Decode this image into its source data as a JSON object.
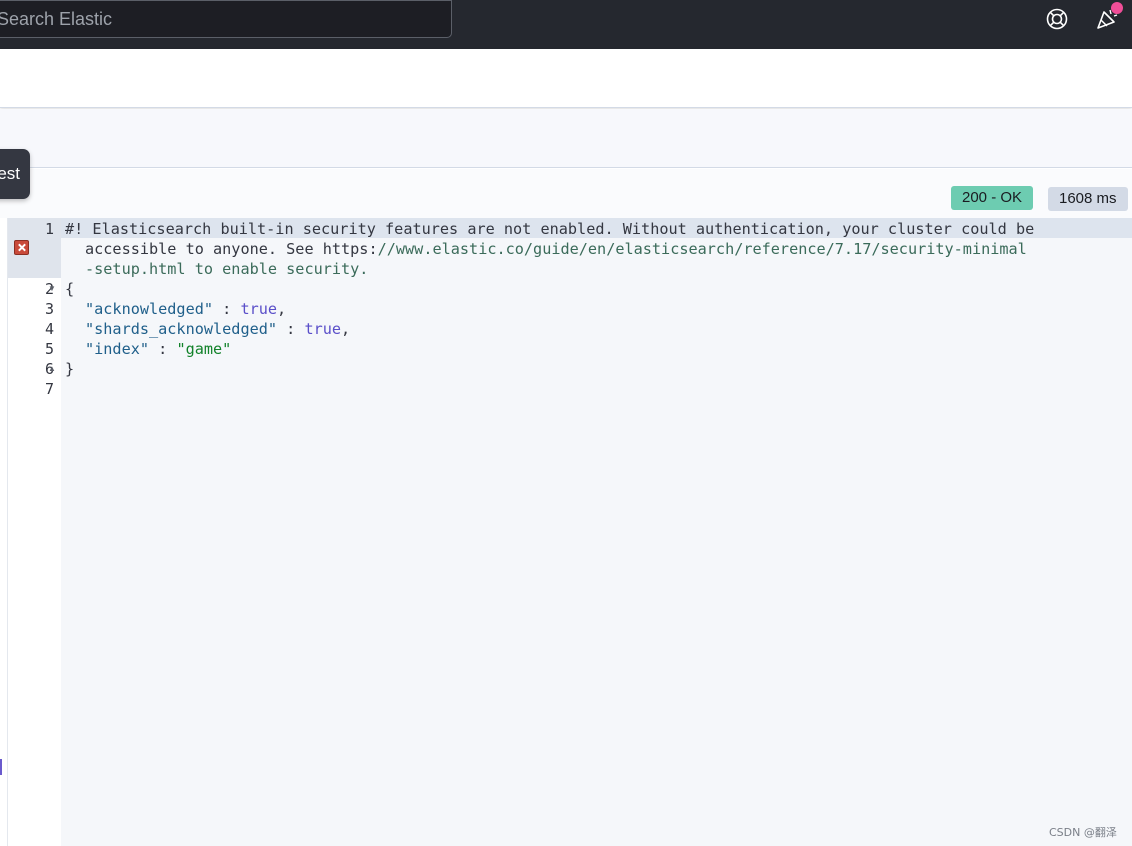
{
  "header": {
    "search_placeholder": "Search Elastic",
    "help_icon": "help-lifebuoy-icon",
    "news_icon": "newsfeed-cheer-icon"
  },
  "request_button": {
    "label": "est"
  },
  "response": {
    "status": "200 - OK",
    "time": "1608 ms"
  },
  "editor": {
    "line_numbers": [
      "1",
      "2",
      "3",
      "4",
      "5",
      "6",
      "7"
    ],
    "line1_a": "#! Elasticsearch built-in security features are not enabled. Without authentication, your cluster could be",
    "line1_b_prefix": "accessible to anyone. See https:",
    "line1_b_url": "//www.elastic.co/guide/en/elasticsearch/reference/7.17/security-minimal",
    "line1_c": "-setup.html to enable security.",
    "brace_open": "{",
    "brace_close": "}",
    "rows": [
      {
        "key": "\"acknowledged\"",
        "sep": " : ",
        "value": "true",
        "end": ","
      },
      {
        "key": "\"shards_acknowledged\"",
        "sep": " : ",
        "value": "true",
        "end": ","
      },
      {
        "key": "\"index\"",
        "sep": " : ",
        "value": "\"game\"",
        "end": ""
      }
    ]
  },
  "watermark": "CSDN @翻泽",
  "colors": {
    "topbar": "#25282f",
    "status_ok": "#6dccb1",
    "notification": "#f04e98"
  }
}
